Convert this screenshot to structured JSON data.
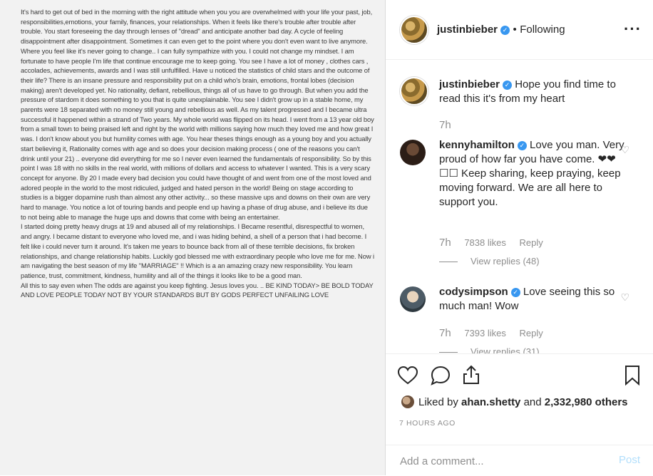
{
  "image_post": {
    "paragraphs": [
      "It's hard to get out of bed in the morning with the right attitude when you you are overwhelmed with your life your past, job, responsibilities,emotions, your family, finances, your relationships. When it feels like there's trouble  after trouble after trouble. You start foreseeing the day through lenses of \"dread\" and anticipate another bad day. A cycle of feeling disappointment after disappointment. Sometimes it can even get to the point where you don't even want to live anymore. Where you feel like it's never going to change.. I can fully sympathize with you. I could not change my mindset. I am fortunate to have people I'm life that continue encourage me to keep going. You see I have a lot of money , clothes cars , accolades, achievements, awards and I was still unfulfilled. Have u noticed the statistics of child stars and the outcome of their life? There is an insane pressure and responsibility put on a child who's brain, emotions, frontal lobes (decision making) aren't developed yet.  No rationality, defiant, rebellious, things all of us have to go through. But when you add the pressure of stardom it does something to you that is quite unexplainable. You see I didn't grow up in a stable home, my parents were 18 separated  with no money still young and rebellious as well. As my talent progressed and I became ultra successful it happened within a strand of Two years. My whole world was flipped on its head. I went from a 13 year old boy from a small town to being praised left and right by the world with millions saying how much they loved me and how great I was. I don't know about you but humility comes with age. You hear theses things enough as a young boy and you actually start believing it, Rationality comes with age and so does your decision making process ( one of the reasons you can't drink until your 21) .. everyone did everything for me so I never even learned the fundamentals of responsibility. So  by this point I was 18 with no skills in the real world, with millions of dollars and access to whatever I wanted. This is a very scary concept for anyone.  By 20 I made every bad decision you could have thought of and went from one of the most loved and adored people in the world to the most ridiculed, judged and hated person in the world! Being on stage according to studies is a bigger dopamine rush than almost any other activity... so these massive ups and downs on their own are very hard to manage. You notice a lot of touring bands and people end up having a phase of drug abuse, and i believe its due to not being able to manage the huge ups and downs that come with being an entertainer.",
      "I started doing pretty heavy drugs at 19 and abused all of my relationships. I Became resentful, disrespectful to women, and angry. I became distant to everyone who loved me, and i was hiding behind, a shell of a person that i had become. I felt like i could never turn it around. It's taken me years to bounce back from all of these terrible decisions, fix broken relationships, and change relationship habits. Luckily god blessed me with extraordinary people who love me for me. Now i am navigating the best season of my life \"MARRIAGE\" !! Which is a an amazing crazy new responsibility. You learn patience, trust, commitment, kindness, humility and all of the things it looks like to be a good man.",
      "All this to say even when The odds are against you keep fighting. Jesus loves you. .. BE KIND TODAY> BE BOLD TODAY AND LOVE PEOPLE TODAY NOT BY YOUR STANDARDS BUT BY GODS PERFECT UNFAILING LOVE"
    ]
  },
  "header": {
    "username": "justinbieber",
    "separator": "•",
    "follow_status": "Following",
    "more_icon": "more-horizontal-icon"
  },
  "caption": {
    "username": "justinbieber",
    "text": "Hope you find time to read this it's from my heart",
    "time": "7h"
  },
  "comments": [
    {
      "username": "kennyhamilton",
      "text": "Love you man. Very proud of how far you have come. ❤❤☐☐ Keep sharing, keep praying, keep moving forward. We are all here to support you.",
      "time": "7h",
      "likes": "7838 likes",
      "reply": "Reply",
      "view_replies": "View replies (48)"
    },
    {
      "username": "codysimpson",
      "text": "Love seeing this so much man! Wow",
      "time": "7h",
      "likes": "7393 likes",
      "reply": "Reply",
      "view_replies": "View replies (31)"
    }
  ],
  "liked_by": {
    "prefix": "Liked by ",
    "user": "ahan.shetty",
    "middle": " and ",
    "count": "2,332,980 others"
  },
  "post_time": "7 HOURS AGO",
  "add_comment": {
    "placeholder": "Add a comment...",
    "post_label": "Post"
  },
  "colors": {
    "verified": "#3897f0",
    "post_button": "#b2dffc",
    "muted_text": "#8e8e8e"
  }
}
